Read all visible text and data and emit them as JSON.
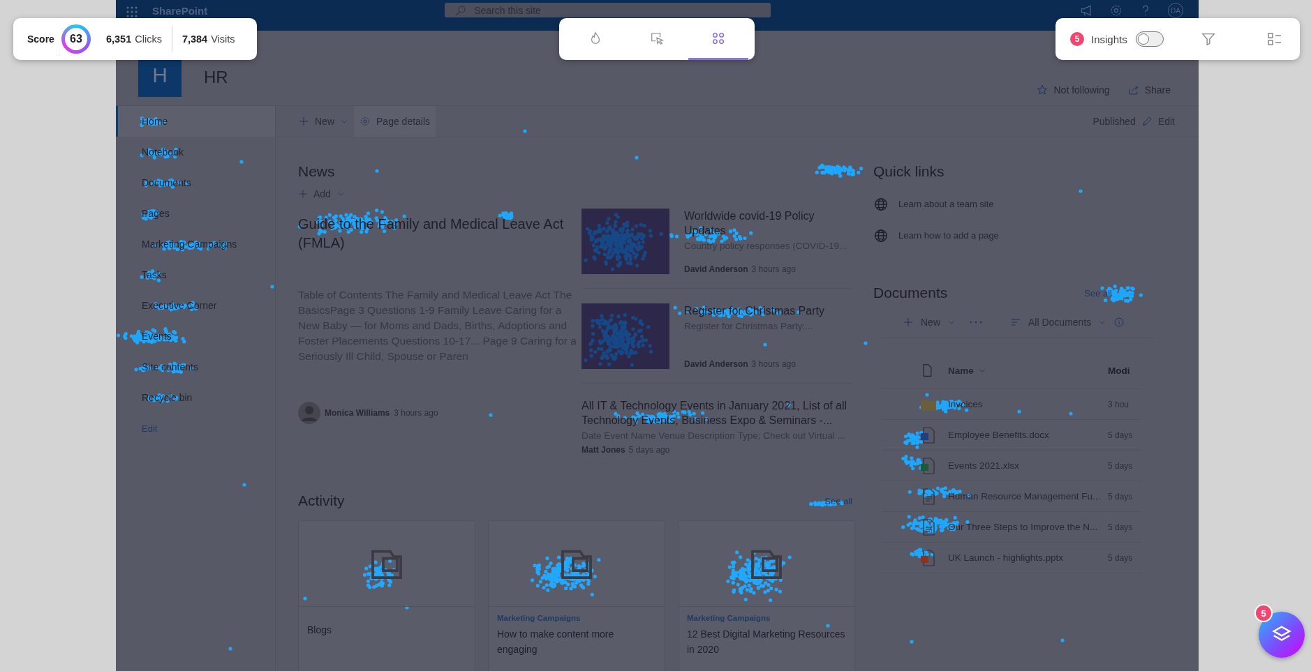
{
  "summary": {
    "score_label": "Score",
    "score": "63",
    "clicks": "6,351",
    "clicks_label": "Clicks",
    "visits": "7,384",
    "visits_label": "Visits"
  },
  "view_tabs": [
    {
      "kind": "heat",
      "selected": false
    },
    {
      "kind": "click",
      "selected": false
    },
    {
      "kind": "grid",
      "selected": true
    }
  ],
  "insights": {
    "badge": "5",
    "label": "Insights",
    "on": false
  },
  "suite_bar": {
    "app_name": "SharePoint",
    "search_placeholder": "Search this site",
    "avatar": "DA"
  },
  "site": {
    "logo_letter": "H",
    "title": "HR",
    "follow": "Not following",
    "share": "Share"
  },
  "nav": {
    "items": [
      {
        "label": "Home",
        "selected": true
      },
      {
        "label": "Notebook",
        "selected": false
      },
      {
        "label": "Documents",
        "selected": false
      },
      {
        "label": "Pages",
        "selected": false
      },
      {
        "label": "Marketing Campaigns",
        "selected": false
      },
      {
        "label": "Tasks",
        "selected": false
      },
      {
        "label": "Executive Corner",
        "selected": false
      },
      {
        "label": "Events",
        "selected": false
      },
      {
        "label": "Site contents",
        "selected": false
      },
      {
        "label": "Recycle bin",
        "selected": false
      }
    ],
    "edit": "Edit"
  },
  "command_bar": {
    "new": "New",
    "page_details": "Page details",
    "status": "Published",
    "edit": "Edit"
  },
  "news": {
    "title": "News",
    "add": "Add",
    "featured": {
      "title": "Guide to the Family and Medical Leave Act (FMLA)",
      "excerpt": "Table of Contents The Family and Medical Leave Act The BasicsPage 3 Questions 1-9 Family Leave Caring for a New Baby — for Moms and Dads, Births, Adoptions and Foster Placements Questions 10-17... Page 9 Caring for a Seriously Ill Child, Spouse or Paren",
      "author": "Monica Williams",
      "time": "3 hours ago"
    },
    "items": [
      {
        "kind": "thumbnail",
        "title": "Worldwide covid-19 Policy Updates",
        "excerpt": "Country policy responses (COVID-19...",
        "author": "David Anderson",
        "time": "3 hours ago"
      },
      {
        "kind": "thumbnail",
        "title": "Register for Christmas Party",
        "excerpt": "Register for Christmas Party:...",
        "author": "David Anderson",
        "time": "3 hours ago"
      },
      {
        "kind": "text",
        "title": "All IT & Technology Events in January 2021, List of all Technology Events, Business Expo & Seminars -...",
        "excerpt": "Date Event Name Venue Description Type; Check out Virtual ...",
        "author": "Matt Jones",
        "time": "5 days ago"
      }
    ]
  },
  "quick_links": {
    "title": "Quick links",
    "items": [
      "Learn about a team site",
      "Learn how to add a page"
    ]
  },
  "documents": {
    "title": "Documents",
    "see_all": "See all",
    "new": "New",
    "view": "All Documents",
    "columns": [
      "Name",
      "Modi"
    ],
    "rows": [
      {
        "kind": "folder",
        "name": "Invoices",
        "modified": "3 hou"
      },
      {
        "kind": "word",
        "name": "Employee Benefits.docx",
        "modified": "5 days"
      },
      {
        "kind": "excel",
        "name": "Events 2021.xlsx",
        "modified": "5 days"
      },
      {
        "kind": "pdf",
        "name": "Human Resource Management Fu...",
        "modified": "5 days"
      },
      {
        "kind": "pdf",
        "name": "Our Three Steps to Improve the N...",
        "modified": "5 days"
      },
      {
        "kind": "powerpoint",
        "name": "UK Launch - highlights.pptx",
        "modified": "5 days"
      }
    ]
  },
  "activity": {
    "title": "Activity",
    "see_all": "See all",
    "cards": [
      {
        "title": "Blogs"
      },
      {
        "category": "Marketing Campaigns",
        "title": "How to make content more engaging"
      },
      {
        "category": "Marketing Campaigns",
        "title": "12 Best Digital Marketing Resources in 2020"
      }
    ]
  },
  "layers_button": {
    "badge": "5"
  }
}
